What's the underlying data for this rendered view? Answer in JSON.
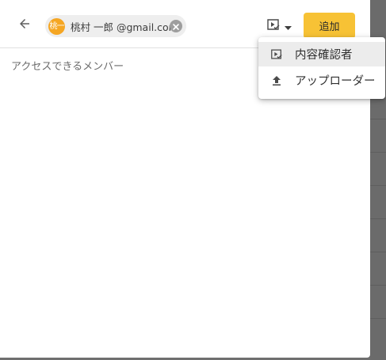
{
  "header": {
    "recipient_chip": {
      "avatar_text": "桃一",
      "label": "桃村 一郎 @gmail.com"
    },
    "add_button_label": "追加"
  },
  "main": {
    "section_title": "アクセスできるメンバー"
  },
  "role_menu": {
    "items": [
      {
        "label": "内容確認者",
        "icon": "reviewer-icon",
        "selected": true
      },
      {
        "label": "アップローダー",
        "icon": "upload-icon",
        "selected": false
      }
    ]
  },
  "colors": {
    "accent": "#f7c235",
    "avatar": "#f5a623",
    "chip_bg": "#eeeeee",
    "backdrop": "#6f6f6f"
  }
}
